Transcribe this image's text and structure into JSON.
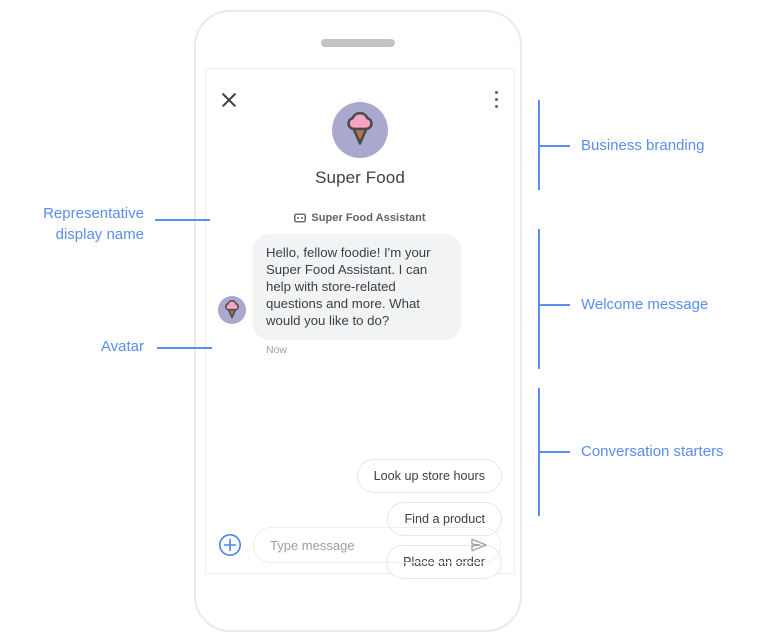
{
  "phone": {
    "speaker_name": "phone-speaker"
  },
  "chat": {
    "header": {
      "close_icon": "close-icon",
      "menu_icon": "overflow-menu-icon"
    },
    "branding": {
      "logo_icon": "ice-cream-logo-icon",
      "business_name": "Super Food"
    },
    "representative": {
      "bot_icon": "bot-icon",
      "display_name": "Super Food Assistant"
    },
    "welcome": {
      "avatar_icon": "ice-cream-avatar-icon",
      "text": "Hello, fellow foodie! I'm your Super Food Assistant. I can help with store-related questions and more. What would you like to do?",
      "timestamp": "Now"
    },
    "conversation_starters": [
      {
        "label": "Look up store hours"
      },
      {
        "label": "Find a product"
      },
      {
        "label": "Place an order"
      }
    ],
    "composer": {
      "add_icon": "plus-circle-icon",
      "input_value": "",
      "input_placeholder": "Type message",
      "send_icon": "send-icon"
    }
  },
  "annotations": {
    "left": [
      {
        "text": "Representative\ndisplay name"
      },
      {
        "text": "Avatar"
      }
    ],
    "right": [
      {
        "text": "Business branding"
      },
      {
        "text": "Welcome message"
      },
      {
        "text": "Conversation starters"
      }
    ]
  },
  "colors": {
    "annotation": "#5b8def",
    "bubble_bg": "#f1f3f4",
    "text_primary": "#3c4043",
    "text_secondary": "#5f6368",
    "logo_circle": "#a9a8cd",
    "scoop_pink": "#f6a5c0",
    "cone_brown": "#b2744a"
  }
}
